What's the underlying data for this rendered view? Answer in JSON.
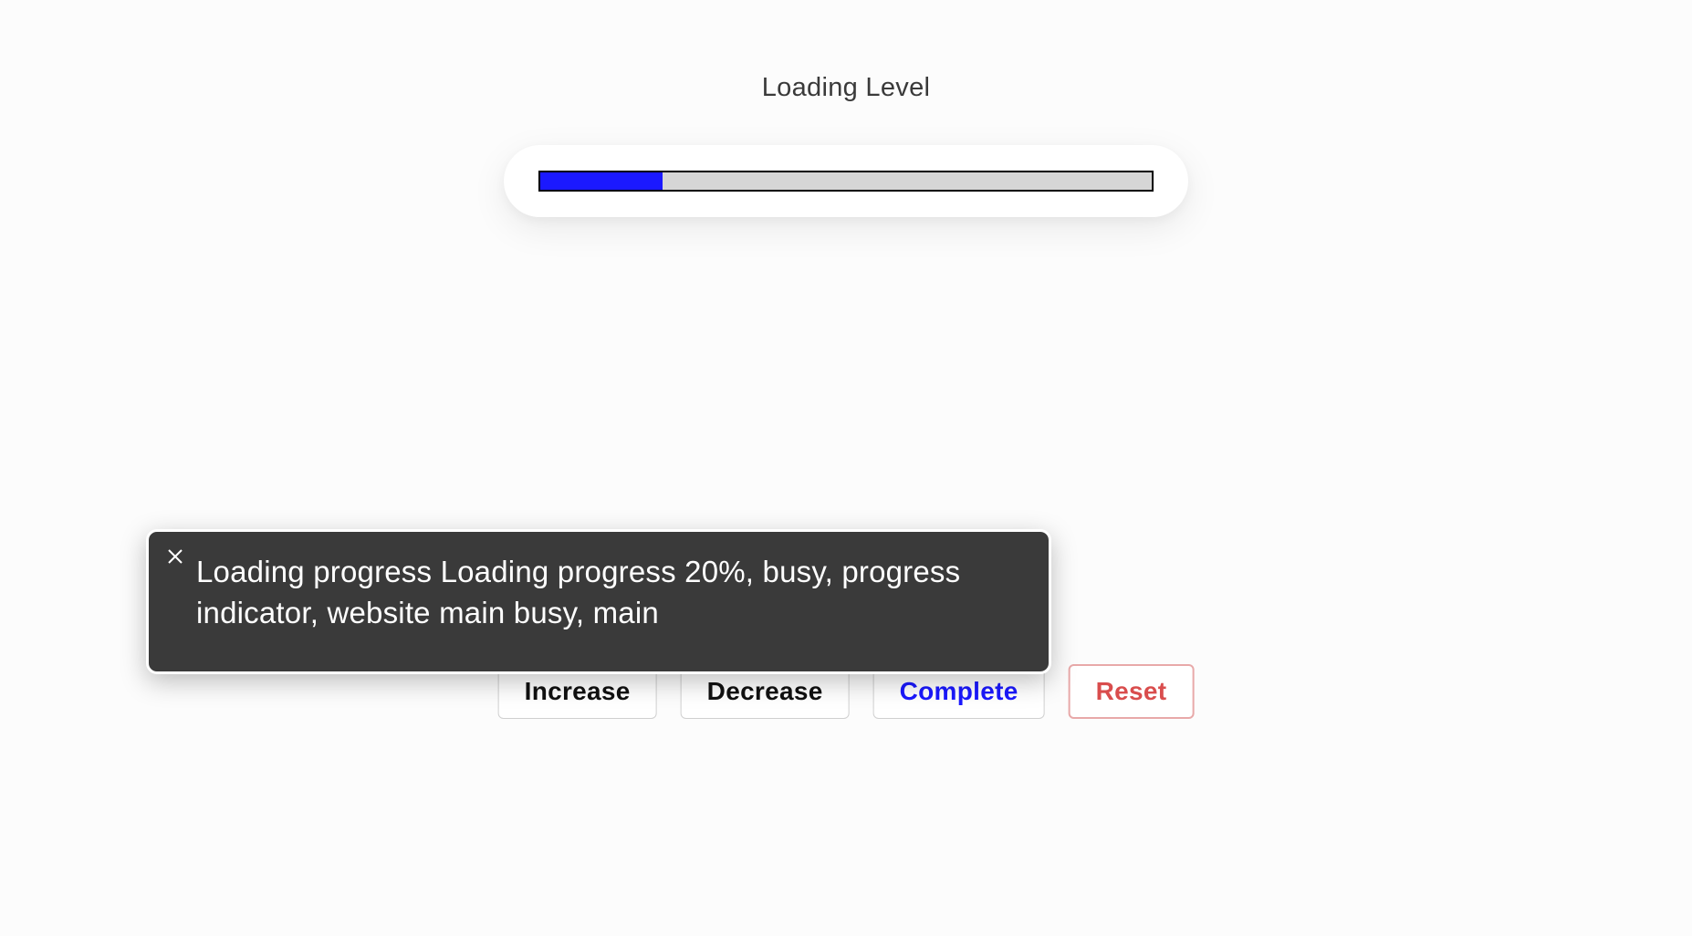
{
  "heading": "Loading Level",
  "progress": {
    "percent": 20
  },
  "tooltip": {
    "text": "Loading progress Loading progress 20%, busy, progress indicator, website main busy, main"
  },
  "buttons": {
    "increase": "Increase",
    "decrease": "Decrease",
    "complete": "Complete",
    "reset": "Reset"
  }
}
